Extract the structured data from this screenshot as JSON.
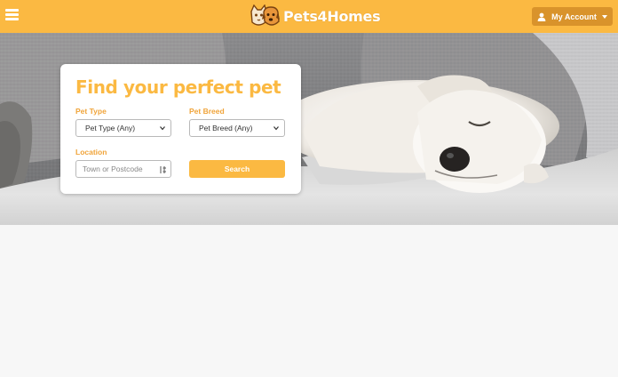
{
  "header": {
    "brand_name": "Pets4Homes",
    "account_label": "My Account",
    "brand_color": "#fbb942",
    "account_color": "#d9932b",
    "icons": {
      "menu": "hamburger-menu-icon",
      "logo": "cat-dog-logo-icon",
      "user": "user-icon",
      "caret": "caret-down-icon"
    }
  },
  "search": {
    "title": "Find your perfect pet",
    "pet_type_label": "Pet Type",
    "pet_type_value": "Pet Type (Any)",
    "pet_breed_label": "Pet Breed",
    "pet_breed_value": "Pet Breed (Any)",
    "location_label": "Location",
    "location_placeholder": "Town or Postcode",
    "search_button": "Search",
    "icons": {
      "dropdown": "chevron-down-icon",
      "location": "location-crosshair-icon"
    }
  },
  "hero": {
    "image": "sleeping-puppy-on-blanket-photo"
  }
}
